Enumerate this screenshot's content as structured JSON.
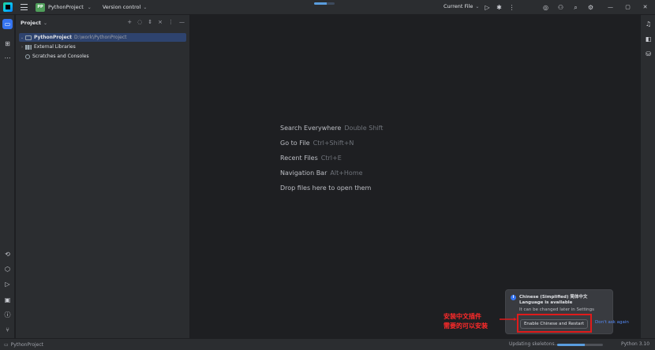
{
  "titlebar": {
    "project_badge": "PP",
    "project_name": "PythonProject",
    "vcs_label": "Version control",
    "run_config": "Current File",
    "indexing_progress": 0.6
  },
  "project_panel": {
    "title": "Project",
    "tree": [
      {
        "name": "PythonProject",
        "path": "D:\\work\\PythonProject",
        "selected": true
      },
      {
        "name": "External Libraries",
        "path": ""
      },
      {
        "name": "Scratches and Consoles",
        "path": ""
      }
    ]
  },
  "editor_hints": [
    {
      "action": "Search Everywhere",
      "shortcut": "Double Shift"
    },
    {
      "action": "Go to File",
      "shortcut": "Ctrl+Shift+N"
    },
    {
      "action": "Recent Files",
      "shortcut": "Ctrl+E"
    },
    {
      "action": "Navigation Bar",
      "shortcut": "Alt+Home"
    },
    {
      "action": "Drop files here to open them",
      "shortcut": ""
    }
  ],
  "notification": {
    "icon": "i",
    "title": "Chinese (Simplified) 简体中文 Language is available",
    "subtitle": "It can be changed later in Settings",
    "button": "Enable Chinese and Restart",
    "link": "Don't ask again"
  },
  "annotation": {
    "line1": "安装中文插件",
    "line2": "需要的可以安装",
    "color": "#e01b1b"
  },
  "statusbar": {
    "project": "PythonProject",
    "status": "Updating skeletons...",
    "progress": 0.6,
    "interpreter": "Python 3.10"
  },
  "colors": {
    "accent": "#3574f0",
    "background": "#1e1f22",
    "panel": "#2b2d30"
  }
}
